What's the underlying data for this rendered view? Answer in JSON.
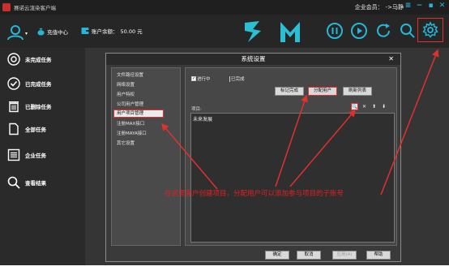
{
  "app": {
    "title": "赛诺云渲染客户端"
  },
  "header": {
    "user_label": "企业会员：",
    "user_name": "->马静",
    "recharge_label": "充值中心",
    "balance_label": "账户余额：",
    "balance_value": "50.00 元"
  },
  "sidebar": {
    "items": [
      {
        "label": "未完成任务",
        "icon": "target-icon"
      },
      {
        "label": "已完成任务",
        "icon": "check-circle-icon"
      },
      {
        "label": "已删除任务",
        "icon": "trash-icon"
      },
      {
        "label": "全部任务",
        "icon": "document-icon"
      },
      {
        "label": "企业任务",
        "icon": "list-icon"
      },
      {
        "label": "查看结果",
        "icon": "search-icon"
      }
    ]
  },
  "dialog": {
    "title": "系统设置",
    "menu": [
      "文件路径设置",
      "网络设置",
      "用户特权",
      "公司用户管理",
      "用户项目管理",
      "注册MAX接口",
      "注册MAYA接口",
      "其它设置"
    ],
    "active_menu": "用户项目管理",
    "filters": {
      "in_progress": "进行中",
      "completed": "已完成",
      "in_progress_checked": "✓"
    },
    "buttons": {
      "mark_complete": "标记完成",
      "assign_user": "分配用户",
      "refresh": "刷新列表"
    },
    "project_label": "项目:",
    "projects": [
      "未来发展"
    ],
    "footer": {
      "ok": "确定",
      "cancel": "取消",
      "apply": "应用(A)",
      "help": "帮助"
    }
  },
  "annotation": {
    "text": "在这里客户创建项目，分配用户可以添加参与项目的子账号"
  },
  "colors": {
    "accent": "#27b6d8",
    "highlight": "#e03030"
  }
}
